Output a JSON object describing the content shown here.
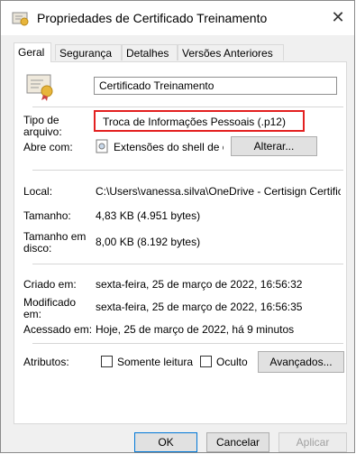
{
  "window": {
    "title": "Propriedades de Certificado Treinamento",
    "close_glyph": "✕"
  },
  "tabs": [
    "Geral",
    "Segurança",
    "Detalhes",
    "Versões Anteriores"
  ],
  "general": {
    "file_name": "Certificado Treinamento",
    "type_label": "Tipo de\narquivo:",
    "type_value": "Troca de Informações Pessoais (.p12)",
    "opens_with_label": "Abre com:",
    "opens_with_value": "Extensões do shell de criptoç",
    "change_button": "Alterar...",
    "location_label": "Local:",
    "location_value": "C:\\Users\\vanessa.silva\\OneDrive - Certisign Certifica",
    "size_label": "Tamanho:",
    "size_value": "4,83 KB (4.951 bytes)",
    "size_on_disk_label": "Tamanho em\ndisco:",
    "size_on_disk_value": "8,00 KB (8.192 bytes)",
    "created_label": "Criado em:",
    "created_value": "sexta-feira, 25 de março de 2022, 16:56:32",
    "modified_label": "Modificado\nem:",
    "modified_value": "sexta-feira, 25 de março de 2022, 16:56:35",
    "accessed_label": "Acessado em:",
    "accessed_value": "Hoje, 25 de março de 2022, há 9 minutos",
    "attributes_label": "Atributos:",
    "readonly_label": "Somente leitura",
    "hidden_label": "Oculto",
    "advanced_button": "Avançados..."
  },
  "footer": {
    "ok": "OK",
    "cancel": "Cancelar",
    "apply": "Aplicar"
  },
  "icons": {
    "title_icon": "certificate-file-icon",
    "file_icon": "certificate-file-icon",
    "shell_icon": "shell-extension-icon"
  },
  "colors": {
    "highlight": "#e32020"
  }
}
